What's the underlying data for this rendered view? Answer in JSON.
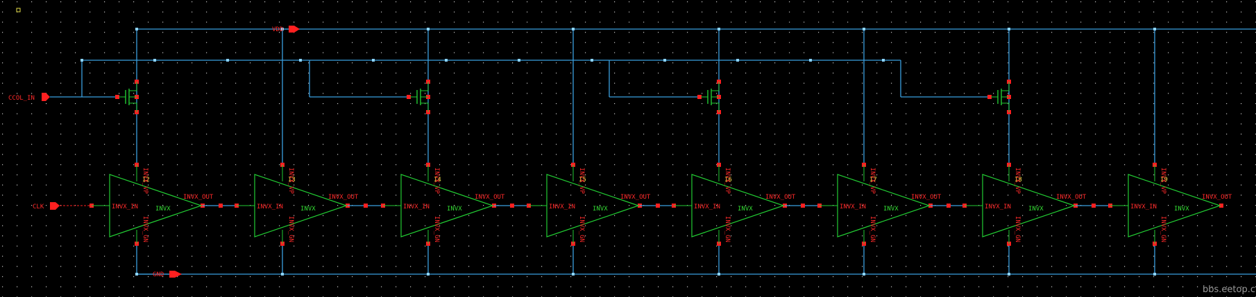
{
  "ports": {
    "vdd": "VDD",
    "gnd": "GND",
    "clk": "CLK",
    "ccol": "CCOL_IN"
  },
  "inverter": {
    "cell": "INVX",
    "in_pin": "INVX_IN",
    "out_pin": "INVX_OUT",
    "vdd_pin": "INVX_VP",
    "gnd_pin": "INVX_GN"
  },
  "instances": [
    "I2",
    "I3",
    "I4",
    "I5",
    "I6",
    "I7",
    "I8",
    "I9"
  ],
  "watermark": "bbs.eetop.cn",
  "colors": {
    "background": "#000000",
    "wire": "#3aa0e0",
    "pin": "#ff2020",
    "symbol": "#22cc33",
    "instance_label": "#e8e04a",
    "grid": "#c8c8c8"
  }
}
